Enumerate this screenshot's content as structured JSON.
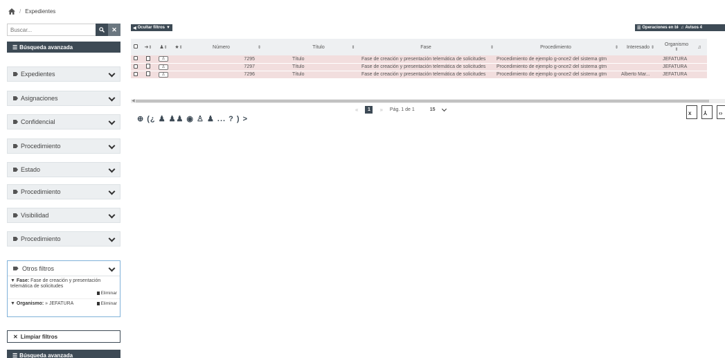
{
  "breadcrumb": {
    "current": "Expedientes"
  },
  "sidebar": {
    "search_placeholder": "Buscar...",
    "advanced_search": "Búsqueda avanzada",
    "filters": [
      "Expedientes",
      "Asignaciones",
      "Confidencial",
      "Procedimiento",
      "Estado",
      "Procedimiento",
      "Visibilidad",
      "Procedimiento"
    ],
    "other_filters": {
      "title": "Otros filtros",
      "active": [
        {
          "label": "Fase:",
          "value": "Fase de creación y presentación telemática de solicitudes",
          "action": "Eliminar"
        },
        {
          "label": "Organismo:",
          "value": "» JEFATURA",
          "action": "Eliminar"
        }
      ]
    },
    "clear_filters": "Limpiar filtros",
    "advanced_search_bottom": "Búsqueda avanzada"
  },
  "toolbar": {
    "hide_filters": "Ocultar filtros",
    "bulk_ops": "Operaciones en bloque",
    "alerts": "Avisos 4"
  },
  "table": {
    "columns": [
      "Número",
      "Título",
      "Fase",
      "Procedimiento",
      "Interesado",
      "Organismo"
    ],
    "rows": [
      {
        "numero": "7295",
        "titulo": "Título",
        "fase": "Fase de creación y presentación telemática de solicitudes",
        "procedimiento": "Procedimiento de ejemplo g-once2 del sistema gtm",
        "interesado": "",
        "organismo": "JEFATURA"
      },
      {
        "numero": "7297",
        "titulo": "Título",
        "fase": "Fase de creación y presentación telemática de solicitudes",
        "procedimiento": "Procedimiento de ejemplo g-once2 del sistema gtm",
        "interesado": "",
        "organismo": "JEFATURA"
      },
      {
        "numero": "7296",
        "titulo": "Título",
        "fase": "Fase de creación y presentación telemática de solicitudes",
        "procedimiento": "Procedimiento de ejemplo g-once2 del sistema gtm",
        "interesado": "Alberto Mar...",
        "organismo": "JEFATURA"
      }
    ]
  },
  "pager": {
    "current": "1",
    "label": "Pág. 1 de 1",
    "page_size": "15"
  },
  "legend": "⊕ (¿ ♟ ♟♟ ◉ ♙ ♟ ... ? ) >",
  "exports": [
    "xls-icon",
    "pdf-icon",
    "xml-icon"
  ]
}
